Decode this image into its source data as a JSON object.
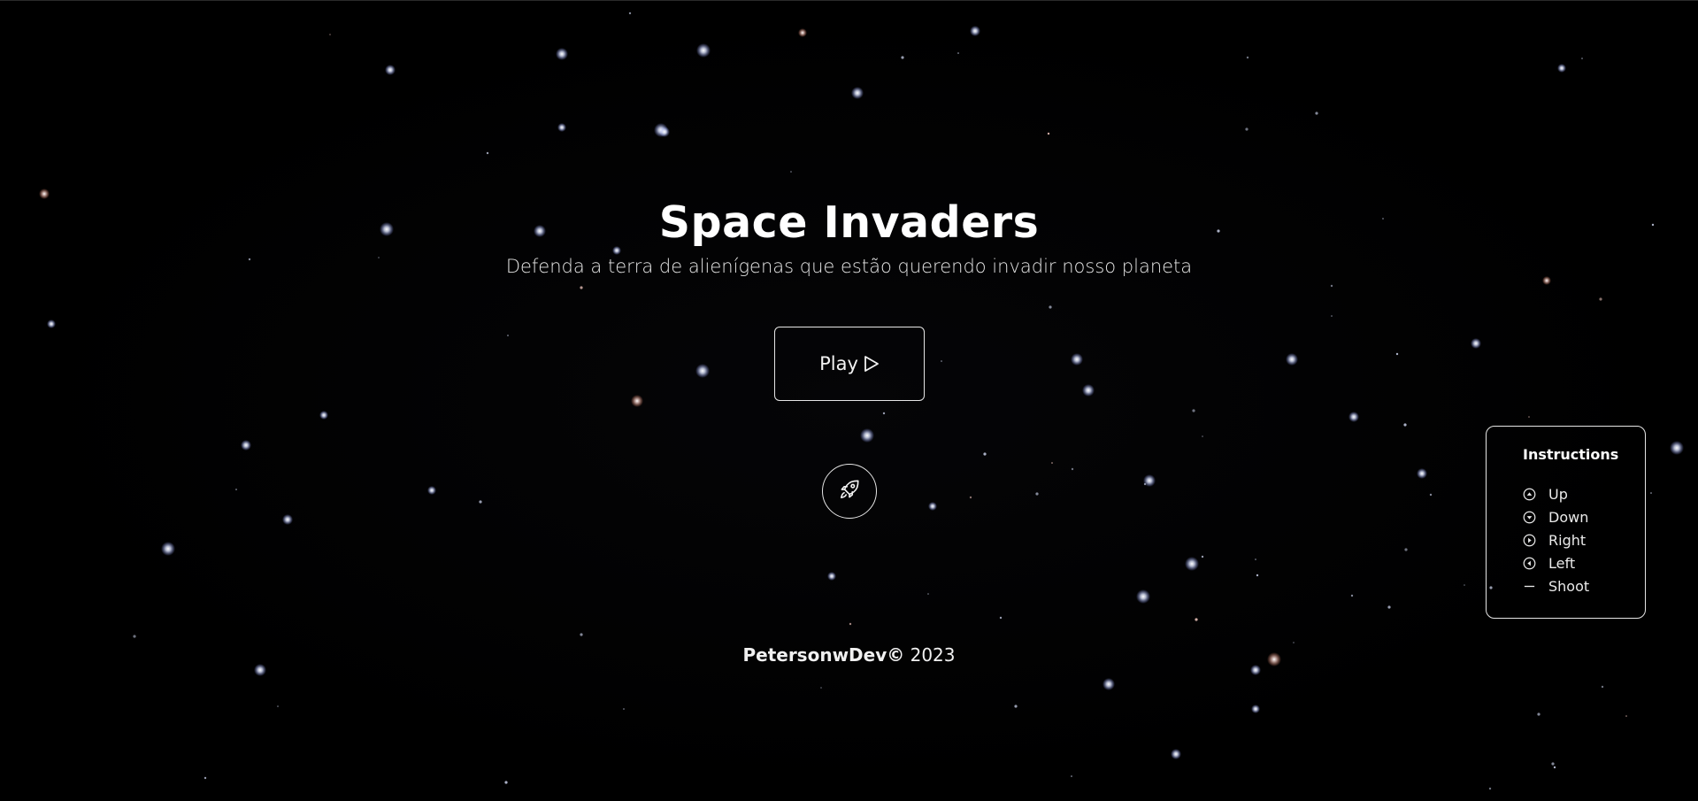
{
  "title": "Space Invaders",
  "subtitle": "Defenda a terra de alienígenas que estão querendo invadir nosso planeta",
  "play_button": {
    "label": "Play",
    "icon": "play-icon"
  },
  "rocket_button": {
    "icon": "rocket-icon"
  },
  "footer": {
    "author": "PetersonwDev©",
    "year": "2023"
  },
  "instructions": {
    "heading": "Instructions",
    "items": [
      {
        "icon": "arrow-up-circle-icon",
        "label": "Up"
      },
      {
        "icon": "arrow-down-circle-icon",
        "label": "Down"
      },
      {
        "icon": "arrow-right-circle-icon",
        "label": "Right"
      },
      {
        "icon": "arrow-left-circle-icon",
        "label": "Left"
      },
      {
        "icon": "space-bar-icon",
        "label": "Shoot"
      }
    ]
  },
  "colors": {
    "background": "#000000",
    "text": "#ffffff",
    "border": "#e6e6e6"
  }
}
